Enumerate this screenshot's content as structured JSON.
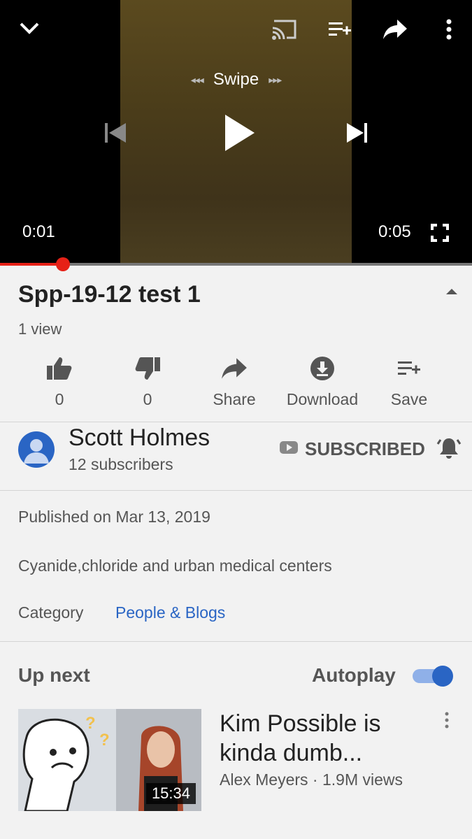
{
  "player": {
    "swipe_label": "Swipe",
    "swipe_left_arrows": "◂◂◂",
    "swipe_right_arrows": "▸▸▸",
    "current_time": "0:01",
    "duration": "0:05",
    "progress_fraction": 0.2,
    "icons": [
      "chevron-down-icon",
      "cast-icon",
      "add-to-queue-icon",
      "share-icon",
      "more-vert-icon",
      "previous-icon",
      "play-icon",
      "next-icon",
      "fullscreen-icon"
    ]
  },
  "video": {
    "title": "Spp-19-12 test 1",
    "views": "1 view"
  },
  "actions": [
    {
      "icon": "thumb-up-icon",
      "label": "0"
    },
    {
      "icon": "thumb-down-icon",
      "label": "0"
    },
    {
      "icon": "share-icon",
      "label": "Share"
    },
    {
      "icon": "download-icon",
      "label": "Download"
    },
    {
      "icon": "playlist-add-icon",
      "label": "Save"
    }
  ],
  "channel": {
    "name": "Scott Holmes",
    "subscribers": "12 subscribers",
    "subscribe_label": "SUBSCRIBED"
  },
  "description": {
    "published": "Published on Mar 13, 2019",
    "text": "Cyanide,chloride and urban medical centers",
    "category_label": "Category",
    "category_value": "People & Blogs"
  },
  "upnext": {
    "heading": "Up next",
    "autoplay_label": "Autoplay",
    "autoplay_on": true,
    "item": {
      "title": "Kim Possible is kinda dumb...",
      "meta": "Alex Meyers · 1.9M views",
      "duration": "15:34"
    }
  },
  "colors": {
    "accent": "#2a65c4",
    "progress": "#e62117",
    "background": "#f2f2f2"
  }
}
